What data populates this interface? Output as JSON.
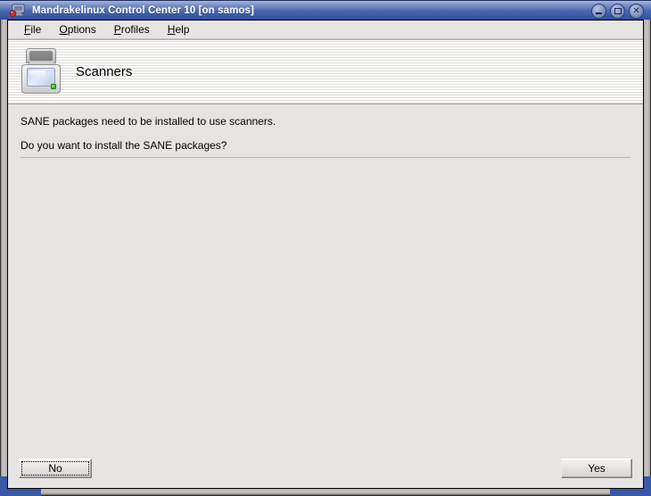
{
  "window": {
    "title": "Mandrakelinux Control Center 10 [on samos]",
    "title_icon": "computer-monitor-icon",
    "controls": {
      "minimize": "minimize-icon",
      "maximize": "maximize-icon",
      "close": "close-icon"
    },
    "close_glyph": "✕"
  },
  "menubar": {
    "items": [
      {
        "label": "File",
        "mnemonic": "F"
      },
      {
        "label": "Options",
        "mnemonic": "O"
      },
      {
        "label": "Profiles",
        "mnemonic": "P"
      },
      {
        "label": "Help",
        "mnemonic": "H"
      }
    ]
  },
  "banner": {
    "icon": "scanner-icon",
    "title": "Scanners"
  },
  "message": {
    "info": "SANE packages need to be installed to use scanners.",
    "question": "Do you want to install the SANE packages?"
  },
  "buttons": {
    "no": "No",
    "yes": "Yes"
  },
  "colors": {
    "titlebar_top": "#a8b6d8",
    "titlebar_bottom": "#2f4d9e",
    "client_background": "#e6e4e2",
    "frame_accent": "#3a58a8",
    "led_green": "#4fc227"
  }
}
